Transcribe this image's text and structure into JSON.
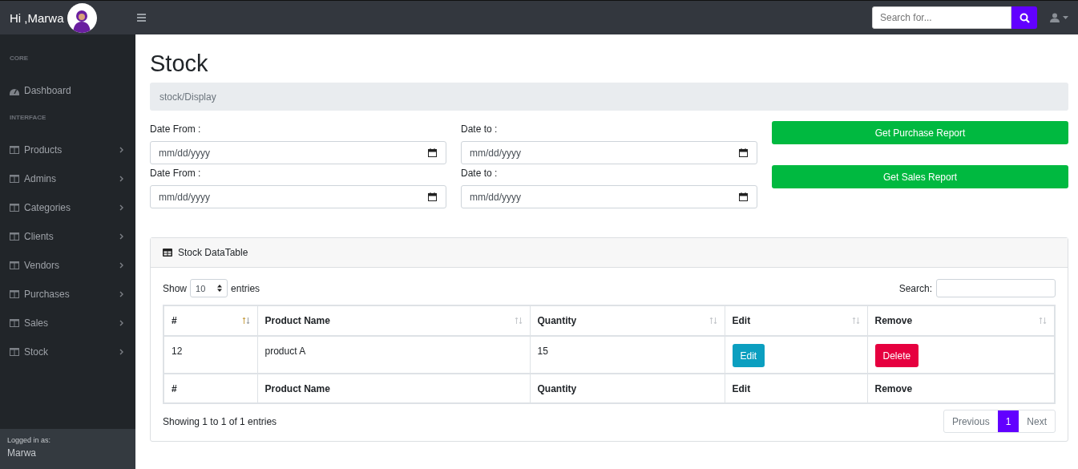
{
  "topbar": {
    "greeting": "Hi ,Marwa",
    "search": {
      "placeholder": "Search for..."
    }
  },
  "sidebar": {
    "sections": [
      {
        "heading": "CORE",
        "items": [
          {
            "label": "Dashboard",
            "kind": "link"
          }
        ]
      },
      {
        "heading": "INTERFACE",
        "items": [
          {
            "label": "Products",
            "kind": "menu"
          },
          {
            "label": "Admins",
            "kind": "menu"
          },
          {
            "label": "Categories",
            "kind": "menu"
          },
          {
            "label": "Clients",
            "kind": "menu"
          },
          {
            "label": "Vendors",
            "kind": "menu"
          },
          {
            "label": "Purchases",
            "kind": "menu"
          },
          {
            "label": "Sales",
            "kind": "menu"
          },
          {
            "label": "Stock",
            "kind": "menu"
          }
        ]
      }
    ],
    "footer": {
      "caption": "Logged in as:",
      "user": "Marwa"
    }
  },
  "page": {
    "title": "Stock",
    "breadcrumb": "stock/Display"
  },
  "report_form": {
    "rows": [
      {
        "fields": [
          {
            "label": "Date From :",
            "placeholder": "mm/dd/yyyy"
          },
          {
            "label": "Date to :",
            "placeholder": "mm/dd/yyyy"
          }
        ],
        "button": "Get Purchase Report"
      },
      {
        "fields": [
          {
            "label": "Date From :",
            "placeholder": "mm/dd/yyyy"
          },
          {
            "label": "Date to :",
            "placeholder": "mm/dd/yyyy"
          }
        ],
        "button": "Get Sales Report"
      }
    ]
  },
  "datatable": {
    "title": "Stock DataTable",
    "length": {
      "before": "Show",
      "value": "10",
      "after": "entries"
    },
    "search_label": "Search:",
    "columns": [
      {
        "label": "#",
        "sorted": true
      },
      {
        "label": "Product Name",
        "sorted": false
      },
      {
        "label": "Quantity",
        "sorted": false
      },
      {
        "label": "Edit",
        "sorted": false
      },
      {
        "label": "Remove",
        "sorted": false
      }
    ],
    "rows": [
      {
        "id": "12",
        "name": "product A",
        "quantity": "15",
        "edit": "Edit",
        "remove": "Delete"
      }
    ],
    "footer": [
      "#",
      "Product Name",
      "Quantity",
      "Edit",
      "Remove"
    ],
    "info": "Showing 1 to 1 of 1 entries",
    "pagination": {
      "previous": "Previous",
      "pages": [
        {
          "label": "1",
          "selected": true
        }
      ],
      "next": "Next"
    }
  }
}
